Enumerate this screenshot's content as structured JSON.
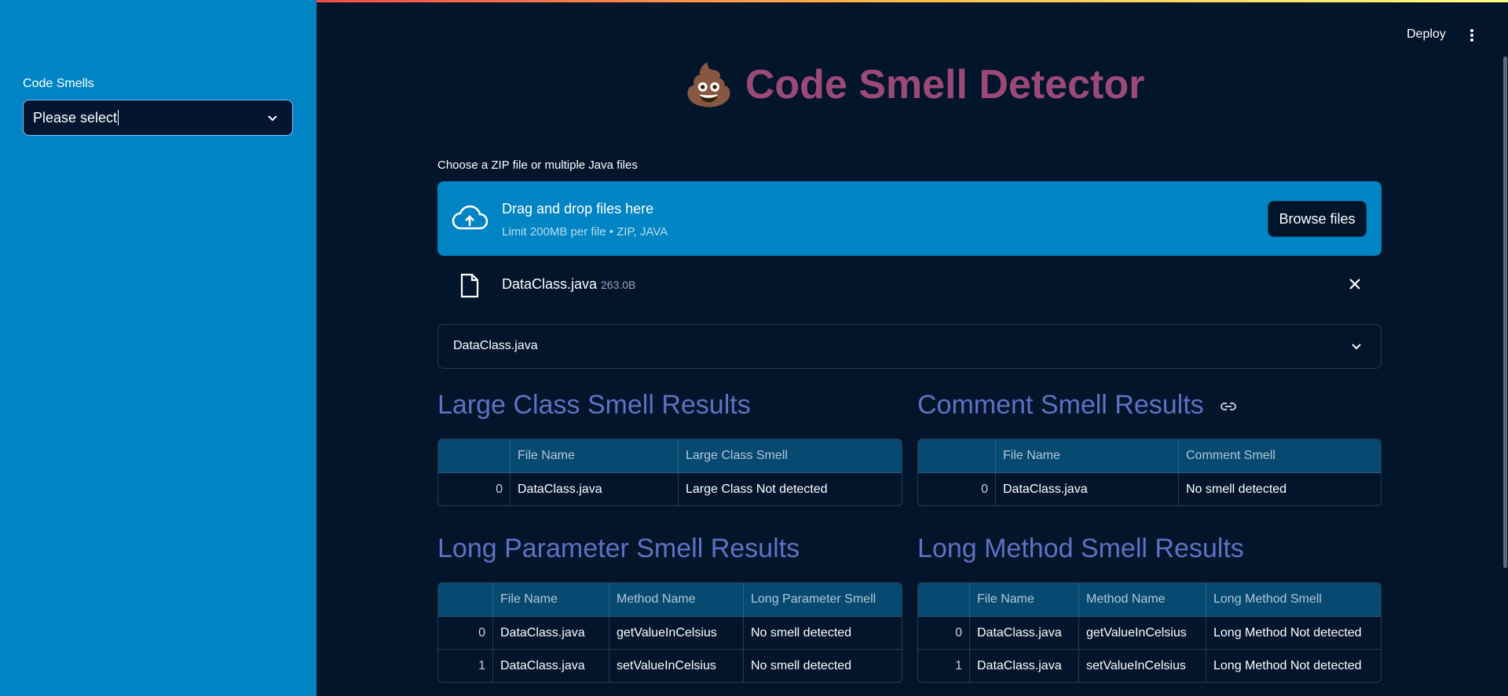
{
  "sidebar": {
    "label": "Code Smells",
    "select_value": "Please select"
  },
  "header": {
    "deploy_label": "Deploy",
    "menu_icon": "kebab-menu-icon"
  },
  "title": {
    "emoji": "💩",
    "text": "Code Smell Detector"
  },
  "uploader": {
    "label": "Choose a ZIP file or multiple Java files",
    "drop_title": "Drag and drop files here",
    "drop_subtitle": "Limit 200MB per file • ZIP, JAVA",
    "browse_label": "Browse files",
    "file": {
      "name": "DataClass.java",
      "size": "263.0B"
    }
  },
  "expander": {
    "label": "DataClass.java"
  },
  "sections": {
    "large_class": {
      "title": "Large Class Smell Results",
      "columns": [
        "",
        "File Name",
        "Large Class Smell"
      ],
      "rows": [
        [
          "0",
          "DataClass.java",
          "Large Class Not detected"
        ]
      ]
    },
    "comment": {
      "title": "Comment Smell Results",
      "columns": [
        "",
        "File Name",
        "Comment Smell"
      ],
      "rows": [
        [
          "0",
          "DataClass.java",
          "No smell detected"
        ]
      ]
    },
    "long_param": {
      "title": "Long Parameter Smell Results",
      "columns": [
        "",
        "File Name",
        "Method Name",
        "Long Parameter Smell"
      ],
      "rows": [
        [
          "0",
          "DataClass.java",
          "getValueInCelsius",
          "No smell detected"
        ],
        [
          "1",
          "DataClass.java",
          "setValueInCelsius",
          "No smell detected"
        ]
      ]
    },
    "long_method": {
      "title": "Long Method Smell Results",
      "columns": [
        "",
        "File Name",
        "Method Name",
        "Long Method Smell"
      ],
      "rows": [
        [
          "0",
          "DataClass.java",
          "getValueInCelsius",
          "Long Method Not detected"
        ],
        [
          "1",
          "DataClass.java",
          "setValueInCelsius",
          "Long Method Not detected"
        ]
      ]
    }
  },
  "colors": {
    "sidebar": "#0184c3",
    "background": "#02152b",
    "title": "#9b4a78",
    "section_title": "#5f71c2",
    "table_header": "#064a72"
  }
}
